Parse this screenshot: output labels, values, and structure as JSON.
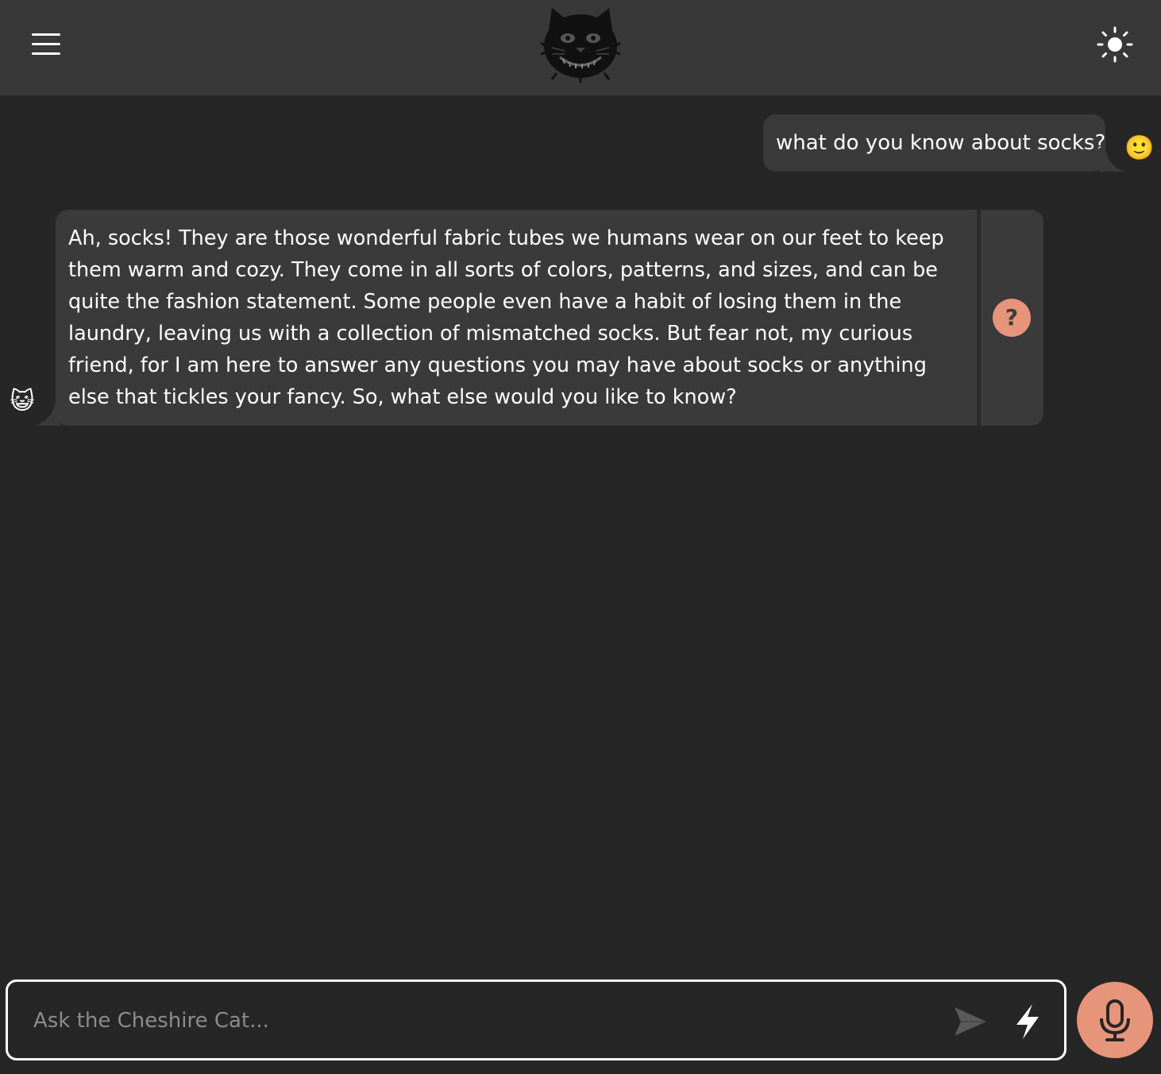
{
  "header": {
    "menu_icon": "hamburger-menu-icon",
    "logo_icon": "cheshire-cat-logo",
    "theme_icon": "sun-icon"
  },
  "messages": [
    {
      "sender": "user",
      "avatar": "🙂",
      "text": "what do you know about socks?"
    },
    {
      "sender": "bot",
      "avatar": "😺",
      "text": "Ah, socks! They are those wonderful fabric tubes we humans wear on our feet to keep them warm and cozy. They come in all sorts of colors, patterns, and sizes, and can be quite the fashion statement. Some people even have a habit of losing them in the laundry, leaving us with a collection of mismatched socks. But fear not, my curious friend, for I am here to answer any questions you may have about socks or anything else that tickles your fancy. So, what else would you like to know?",
      "why_label": "?"
    }
  ],
  "input": {
    "placeholder": "Ask the Cheshire Cat...",
    "value": "",
    "send_icon": "send-icon",
    "flash_icon": "lightning-icon",
    "mic_icon": "microphone-icon"
  },
  "colors": {
    "accent": "#e6957a",
    "header_bg": "#383838",
    "page_bg": "#262626",
    "bubble_bg": "#3a3a3a"
  }
}
